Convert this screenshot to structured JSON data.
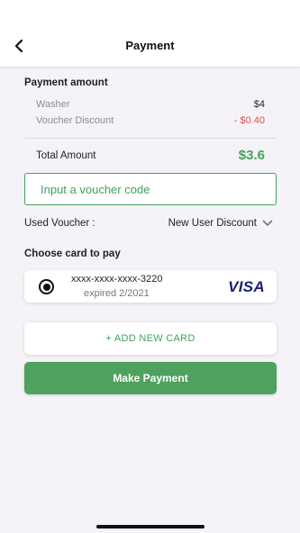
{
  "header": {
    "title": "Payment",
    "back_icon": "chevron-left-icon"
  },
  "payment_amount": {
    "label": "Payment amount",
    "items": [
      {
        "label": "Washer",
        "value": "$4"
      },
      {
        "label": "Voucher Discount",
        "value": "- $0.40"
      }
    ],
    "total_label": "Total Amount",
    "total_value": "$3.6"
  },
  "voucher": {
    "input_placeholder": "Input a voucher code",
    "used_label": "Used Voucher :",
    "used_value": "New User Discount",
    "dropdown_icon": "chevron-down-icon"
  },
  "cards": {
    "label": "Choose card to pay",
    "selected": {
      "number": "xxxx-xxxx-xxxx-3220",
      "expiry": "expired 2/2021",
      "brand": "VISA"
    },
    "add_label": "+ ADD NEW CARD"
  },
  "actions": {
    "pay_label": "Make Payment"
  },
  "colors": {
    "accent": "#43a25a",
    "discount": "#d9534f",
    "visa": "#1a1f71"
  }
}
